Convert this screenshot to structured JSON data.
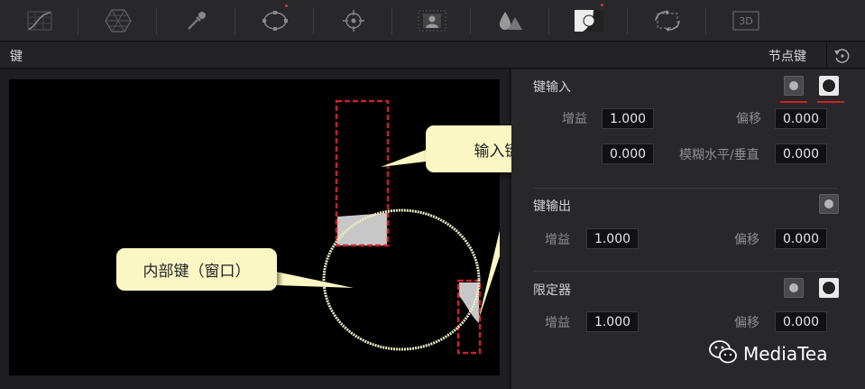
{
  "toolbar": {
    "tools": [
      {
        "name": "curves-icon"
      },
      {
        "name": "color-warper-icon"
      },
      {
        "name": "qualifier-eyedropper-icon"
      },
      {
        "name": "power-window-icon"
      },
      {
        "name": "tracker-icon"
      },
      {
        "name": "magic-mask-icon"
      },
      {
        "name": "blur-icon"
      },
      {
        "name": "key-icon"
      },
      {
        "name": "sizing-icon"
      },
      {
        "name": "3d-icon",
        "label": "3D"
      }
    ],
    "active_tool": "key-icon",
    "accent_red": "#d01f2a"
  },
  "header": {
    "title": "键",
    "node_key_label": "节点键",
    "reset_icon": "reset-icon"
  },
  "viewer": {
    "callout_input": "输入键",
    "callout_internal": "内部键（窗口）"
  },
  "panel": {
    "key_input": {
      "title": "键输入",
      "gain_label": "增益",
      "gain_value": "1.000",
      "offset_label": "偏移",
      "offset_value": "0.000",
      "blur_label": "模糊水平/垂直",
      "blur_value": "0.000",
      "row2_left_value": "0.000"
    },
    "key_output": {
      "title": "键输出",
      "gain_label": "增益",
      "gain_value": "1.000",
      "offset_label": "偏移",
      "offset_value": "0.000"
    },
    "qualifier": {
      "title": "限定器",
      "gain_label": "增益",
      "gain_value": "1.000",
      "offset_label": "偏移",
      "offset_value": "0.000"
    }
  },
  "watermark": {
    "text": "MediaTea",
    "icon": "wechat-icon"
  }
}
